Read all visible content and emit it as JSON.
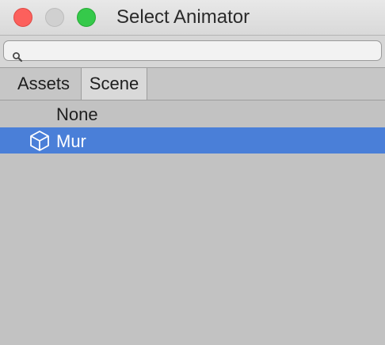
{
  "window": {
    "title": "Select Animator"
  },
  "search": {
    "value": "",
    "placeholder": ""
  },
  "tabs": [
    {
      "label": "Assets",
      "active": false
    },
    {
      "label": "Scene",
      "active": true
    }
  ],
  "items": [
    {
      "label": "None",
      "icon": "",
      "selected": false
    },
    {
      "label": "Mur",
      "icon": "gameobject-cube-icon",
      "selected": true
    }
  ],
  "colors": {
    "selection": "#4a7fd8",
    "close": "#fc605c",
    "maximize": "#35c94a"
  }
}
